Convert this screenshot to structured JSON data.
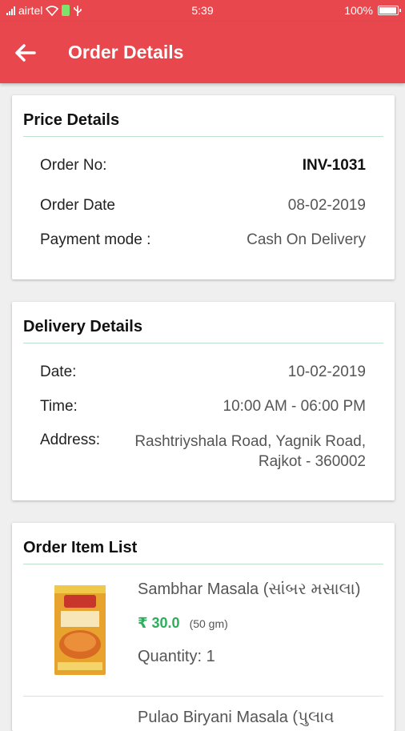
{
  "status_bar": {
    "carrier": "airtel",
    "time": "5:39",
    "battery": "100%",
    "battery_level": 1.0
  },
  "header": {
    "title": "Order Details",
    "back_icon": "arrow-left-icon",
    "color": "#e8484d"
  },
  "price_details": {
    "title": "Price Details",
    "order_no_label": "Order No:",
    "order_no": "INV-1031",
    "order_date_label": "Order Date",
    "order_date": "08-02-2019",
    "payment_mode_label": "Payment mode :",
    "payment_mode": "Cash On Delivery"
  },
  "delivery_details": {
    "title": "Delivery Details",
    "date_label": "Date:",
    "date": "10-02-2019",
    "time_label": "Time:",
    "time": "10:00 AM - 06:00 PM",
    "address_label": "Address:",
    "address_line1": "Rashtriyshala Road, Yagnik Road,",
    "address_line2": "Rajkot - 360002"
  },
  "order_items": {
    "title": "Order Item List",
    "items": [
      {
        "name": "Sambhar Masala (સાંબર મસાલા)",
        "price": "₹ 30.0",
        "weight": "(50 gm)",
        "quantity_label": "Quantity:",
        "quantity": "1",
        "image_icon": "masala-box-image"
      },
      {
        "name": "Pulao Biryani Masala (પુલાવ"
      }
    ]
  },
  "colors": {
    "accent": "#e8484d",
    "price_green": "#2eae5c",
    "divider": "#bfe0cc"
  }
}
